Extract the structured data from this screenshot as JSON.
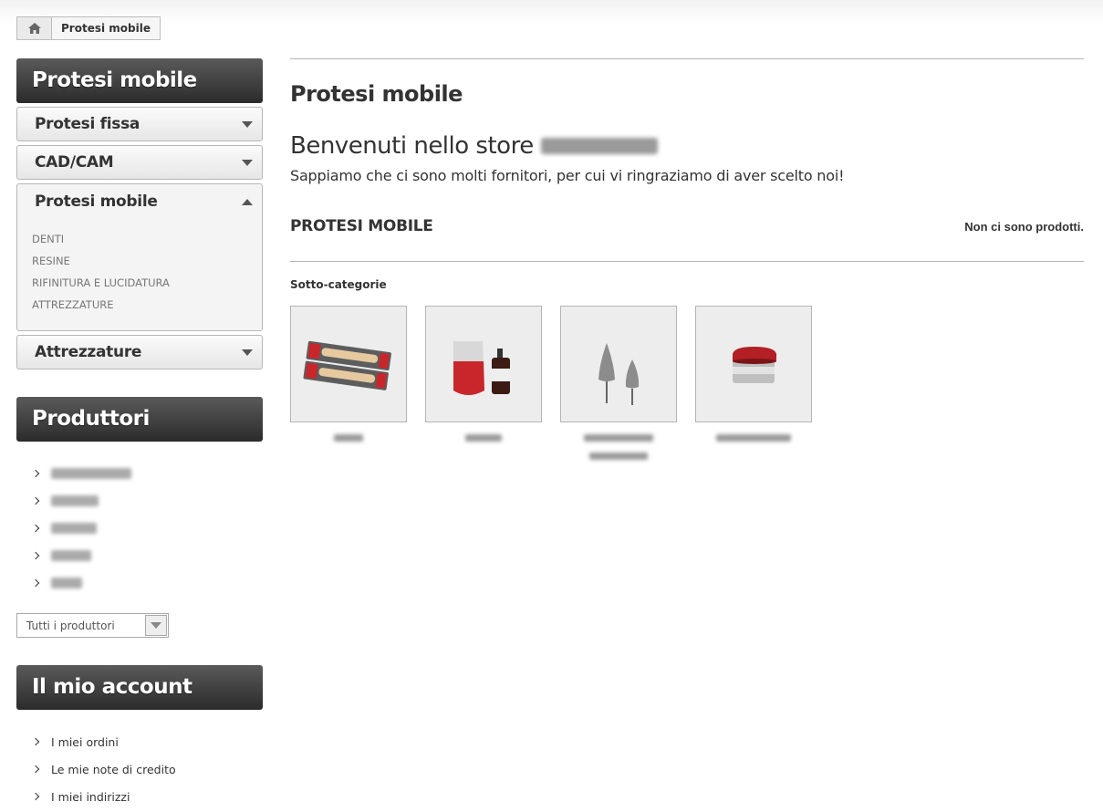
{
  "breadcrumb": {
    "home_icon": "home-icon",
    "current": "Protesi mobile"
  },
  "sidebar": {
    "category_block_title": "Protesi mobile",
    "categories": [
      {
        "label": "Protesi fissa",
        "state": "collapsed"
      },
      {
        "label": "CAD/CAM",
        "state": "collapsed"
      },
      {
        "label": "Protesi mobile",
        "state": "expanded",
        "children": [
          "DENTI",
          "RESINE",
          "RIFINITURA E LUCIDATURA",
          "ATTREZZATURE"
        ]
      },
      {
        "label": "Attrezzature",
        "state": "collapsed"
      }
    ],
    "manufacturers_title": "Produttori",
    "manufacturers_select": "Tutti i produttori",
    "account_title": "Il mio account",
    "account_links": [
      "I miei ordini",
      "Le mie note di credito",
      "I miei indirizzi"
    ]
  },
  "main": {
    "title": "Protesi mobile",
    "welcome": "Benvenuti nello store",
    "welcome_sub": "Sappiamo che ci sono molti fornitori, per cui  vi ringraziamo di aver scelto noi!",
    "category_heading": "PROTESI MOBILE",
    "no_products": "Non ci sono prodotti.",
    "subcategories_label": "Sotto-categorie",
    "subcategory_images": [
      "teeth-package-image",
      "resin-bottle-image",
      "polishing-burs-image",
      "equipment-device-image"
    ]
  },
  "colors": {
    "title_bar_top": "#5a5a5a",
    "title_bar_bottom": "#2b2b2b",
    "accent_red": "#c8262b"
  }
}
